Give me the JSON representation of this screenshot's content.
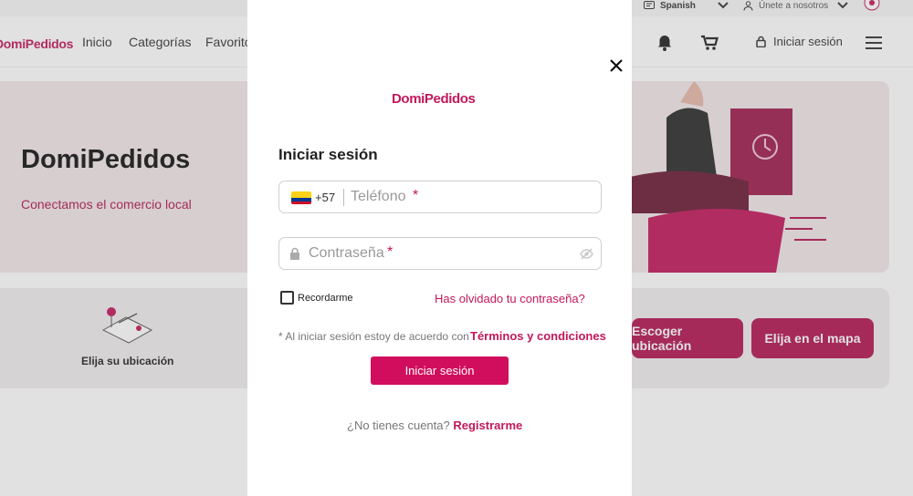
{
  "topbar": {
    "language": "Spanish",
    "join": "Únete a nosotros"
  },
  "nav": {
    "brand": "DomiPedidos",
    "links": [
      "Inicio",
      "Categorías",
      "Favoritos"
    ],
    "login": "Iniciar sesión"
  },
  "hero": {
    "title": "DomiPedidos",
    "subtitle": "Conectamos el comercio local"
  },
  "location": {
    "label": "Elija su ubicación",
    "choose_button": "Escoger ubicación",
    "map_button": "Elija en el mapa"
  },
  "modal": {
    "logo_text": "DomiPedidos",
    "title": "Iniciar sesión",
    "dial_code": "+57",
    "phone_placeholder": "Teléfono",
    "password_placeholder": "Contraseña",
    "required_mark": "*",
    "remember_label": "Recordarme",
    "forgot_link": "Has olvidado tu contraseña?",
    "terms_text": "* Al iniciar sesión estoy de acuerdo con",
    "terms_link": "Términos y condiciones",
    "submit_label": "Iniciar sesión",
    "signup_text": "¿No tienes cuenta?",
    "signup_link": "Registrarme"
  },
  "colors": {
    "brand": "#c2185b",
    "button": "#d10e5d",
    "hero_bg": "#f3e7ea"
  },
  "icons": [
    "translate-icon",
    "chevron-down-icon",
    "user-icon",
    "theme-icon",
    "bell-icon",
    "cart-icon",
    "lock-icon",
    "menu-icon",
    "close-icon",
    "flag-colombia-icon",
    "eye-off-icon"
  ]
}
